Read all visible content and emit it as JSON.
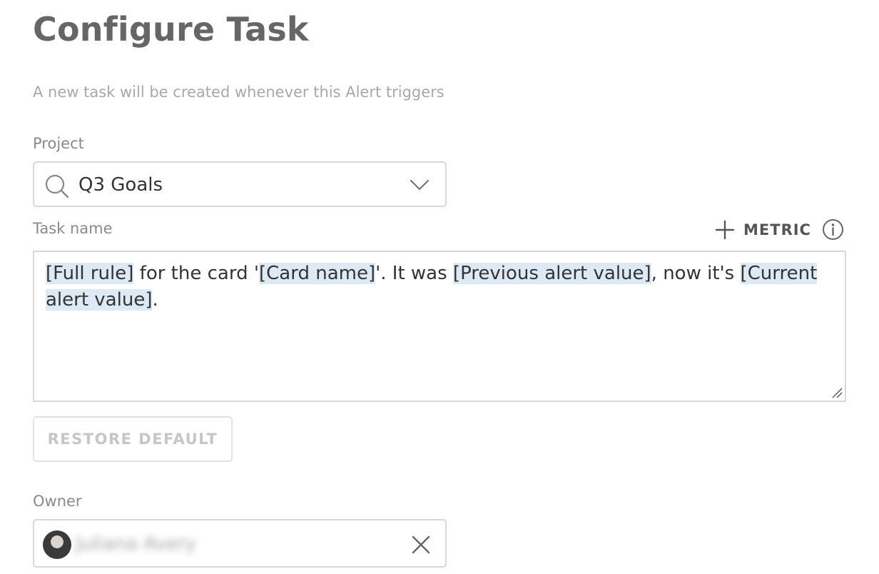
{
  "header": {
    "title": "Configure Task",
    "subtitle": "A new task will be created whenever this Alert triggers"
  },
  "project": {
    "label": "Project",
    "value": "Q3 Goals",
    "icon": "search-icon"
  },
  "task_name": {
    "label": "Task name",
    "metric_label": "METRIC",
    "segments": [
      {
        "text": "[Full rule]",
        "token": true
      },
      {
        "text": " for the card '",
        "token": false
      },
      {
        "text": "[Card name]",
        "token": true
      },
      {
        "text": "'.  It was ",
        "token": false
      },
      {
        "text": "[Previous alert value]",
        "token": true
      },
      {
        "text": ", now it's ",
        "token": false
      },
      {
        "text": "[Current alert value]",
        "token": true
      },
      {
        "text": ".",
        "token": false
      }
    ]
  },
  "restore_default": {
    "label": "RESTORE DEFAULT",
    "disabled": true
  },
  "owner": {
    "label": "Owner",
    "value": "Juliana Avery"
  },
  "colors": {
    "token_highlight": "#dde9f5",
    "border": "#d8d8d8",
    "title": "#666666"
  }
}
